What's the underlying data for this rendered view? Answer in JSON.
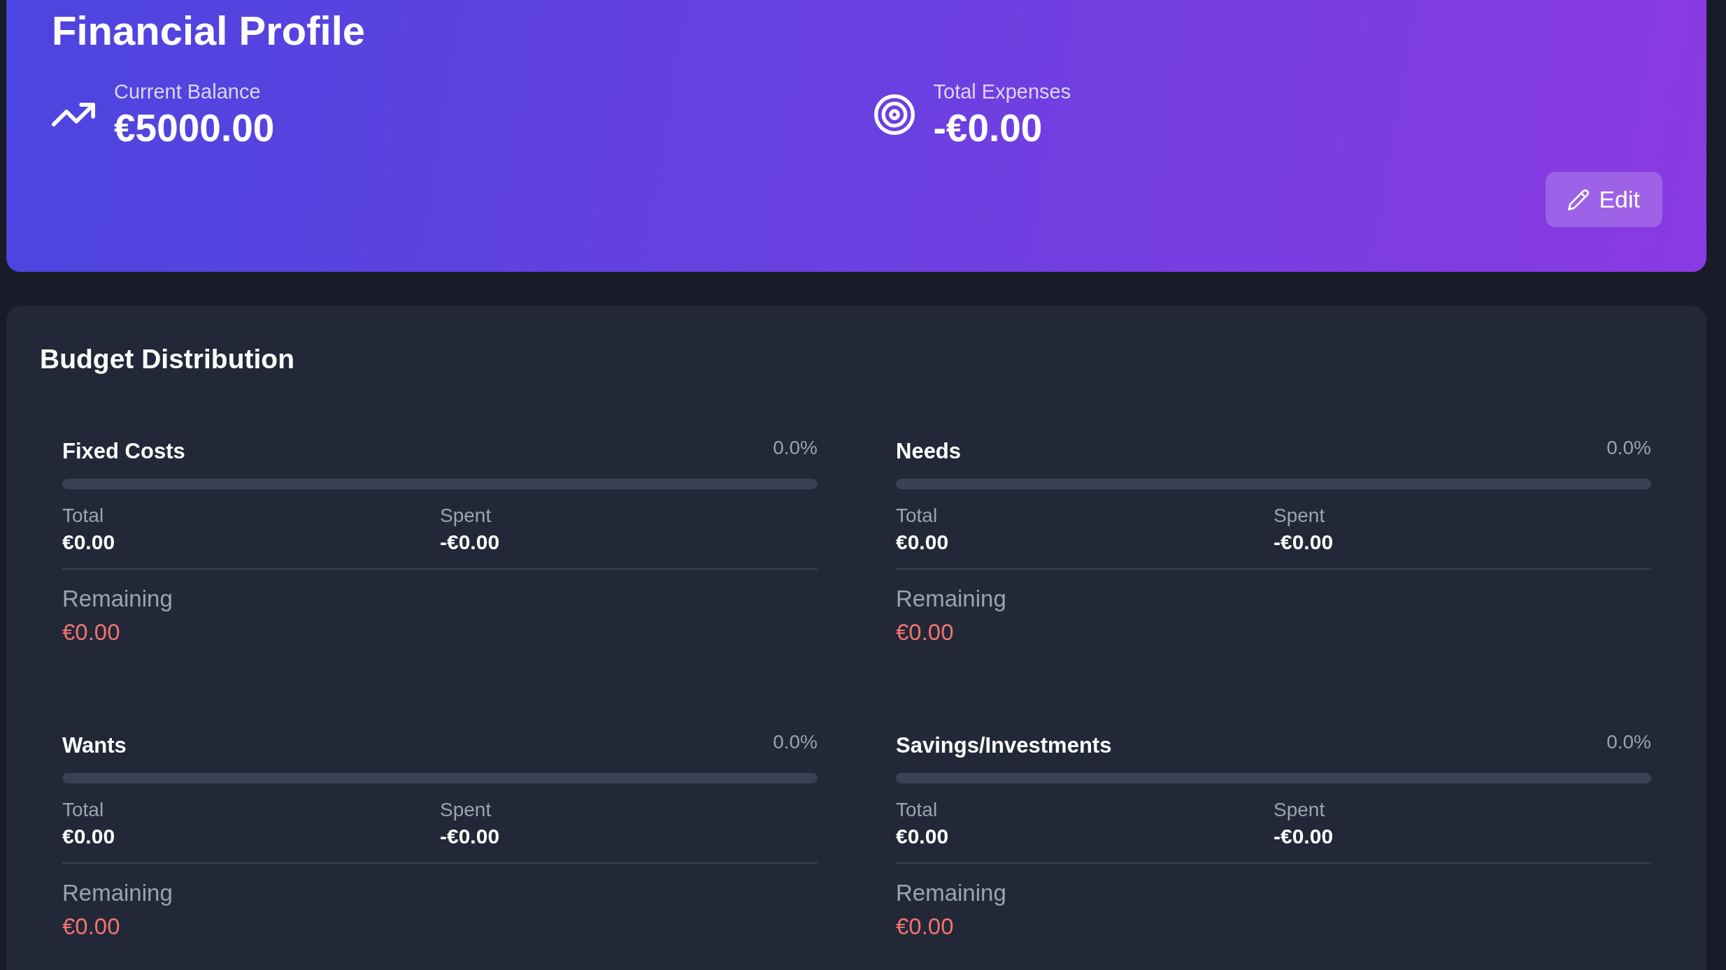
{
  "header": {
    "title": "Financial Profile",
    "stats": [
      {
        "kind": "trend",
        "label": "Current Balance",
        "value": "€5000.00"
      },
      {
        "kind": "target",
        "label": "Total Expenses",
        "value": "-€0.00"
      }
    ],
    "edit_button": {
      "label": "Edit"
    }
  },
  "budget": {
    "title": "Budget Distribution",
    "categories": [
      {
        "name": "Fixed Costs",
        "percent": "0.0%",
        "level": 0,
        "total_label": "Total",
        "total": "€0.00",
        "spent_label": "Spent",
        "spent": "-€0.00",
        "remaining_label": "Remaining",
        "remaining": "€0.00"
      },
      {
        "name": "Needs",
        "percent": "0.0%",
        "level": 0,
        "total_label": "Total",
        "total": "€0.00",
        "spent_label": "Spent",
        "spent": "-€0.00",
        "remaining_label": "Remaining",
        "remaining": "€0.00"
      },
      {
        "name": "Wants",
        "percent": "0.0%",
        "level": 0,
        "total_label": "Total",
        "total": "€0.00",
        "spent_label": "Spent",
        "spent": "-€0.00",
        "remaining_label": "Remaining",
        "remaining": "€0.00"
      },
      {
        "name": "Savings/Investments",
        "percent": "0.0%",
        "level": 0,
        "total_label": "Total",
        "total": "€0.00",
        "spent_label": "Spent",
        "spent": "-€0.00",
        "remaining_label": "Remaining",
        "remaining": "€0.00"
      }
    ]
  }
}
